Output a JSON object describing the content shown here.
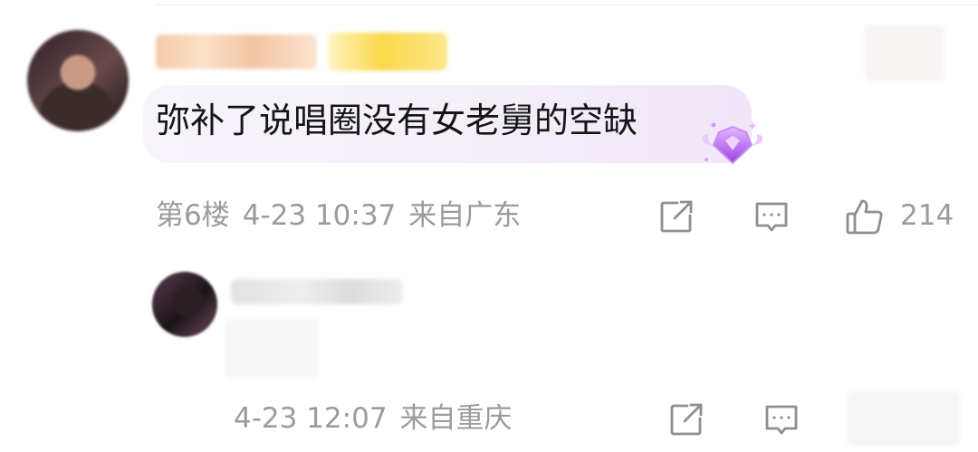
{
  "comment": {
    "text": "弥补了说唱圈没有女老舅的空缺",
    "floor": "第6楼",
    "time": "4-23 10:37",
    "location": "来自广东",
    "like_count": "214"
  },
  "reply": {
    "time": "4-23 12:07",
    "location": "来自重庆"
  },
  "icons": {
    "share": "share-icon",
    "comment": "comment-icon",
    "like": "thumbs-up-icon",
    "badge": "purple-gem-badge-icon"
  },
  "colors": {
    "meta_text": "#9b9b9b",
    "bubble_start": "#f7f4fb",
    "bubble_end": "#f1e6f8",
    "gem": "#b15ef0"
  }
}
